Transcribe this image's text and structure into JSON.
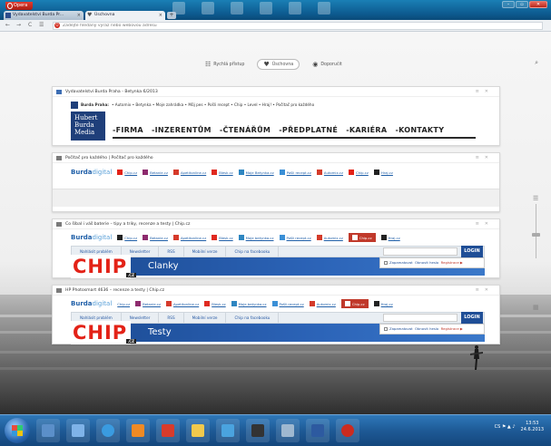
{
  "window": {
    "opera_label": "Opera",
    "controls": [
      "–",
      "▫",
      "✕"
    ]
  },
  "tabs": [
    {
      "label": "Vydavatelství Burda Pr...",
      "close": "×",
      "active": false
    },
    {
      "label": "Úschovna",
      "close": "×",
      "active": true
    }
  ],
  "new_tab_label": "+",
  "address": {
    "back": "←",
    "forward": "→",
    "reload": "C",
    "speed": "☰",
    "placeholder": "Zadejte hledaný výraz nebo webovou adresu"
  },
  "speeddial": {
    "items": [
      {
        "label": "Rychlá přístup",
        "icon": "grid-icon"
      },
      {
        "label": "Úschovna",
        "icon": "heart-icon",
        "active": true
      },
      {
        "label": "Doporučit",
        "icon": "eye-icon"
      }
    ]
  },
  "cards": {
    "burda_praha": {
      "title": "Vydavatelství Burda Praha - Betynka 6/2013",
      "nav_brand": "Burda Praha:",
      "nav_items": [
        "• Automix",
        "• Betynka",
        "• Moje zahrádka",
        "• Můj pes",
        "• Pošli recept",
        "• Chip",
        "• Level",
        "• Hraj!",
        "• Počítač pro každého"
      ],
      "logo_lines": [
        "Hubert",
        "Burda",
        "Media"
      ],
      "menu": [
        "-FIRMA",
        "-INZERENTŮM",
        "-ČTENÁŘŮM",
        "-PŘEDPLATNÉ",
        "-KARIÉRA",
        "-KONTAKTY"
      ]
    },
    "pocitac": {
      "title": "Počítač pro každého | Počítač pro každého",
      "logo_a": "Burda",
      "logo_b": "digital",
      "links": [
        "Chip.cz",
        "Betanie.cz",
        "Apetitonline.cz",
        "Blesk.cz",
        "Moje Betynka.cz",
        "Pošli recept.cz",
        "Automix.cz",
        "Chip.cz",
        "Hraj.cz"
      ]
    },
    "chip_clanky": {
      "title": "Co šíbal i váš baterie – tipy a triky, recenze a testy | Chip.cz",
      "logo_a": "Burda",
      "logo_b": "digital",
      "links": [
        "Chip.cz",
        "Betanie.cz",
        "Apetitonline.cz",
        "Blesk.cz",
        "Moje betynka.cz",
        "Pošli recept.cz",
        "Automix.cz",
        "Chip.cz",
        "Hraj.cz"
      ],
      "bar": [
        "Nahlásit problém",
        "Newsletter",
        "RSS",
        "Mobilní verze",
        "Chip na facebooku"
      ],
      "login": "LOGIN",
      "chip_logo": "CHIP",
      "chip_cz": ".CZ",
      "section": "Clanky",
      "remember": "Zapamatovat",
      "forgot": "Obnovit heslo",
      "register": "Registrace ▶"
    },
    "chip_testy": {
      "title": "HP Photosmart 4636 – recenze a testy | Chip.cz",
      "logo_a": "Burda",
      "logo_b": "digital",
      "links": [
        "Chip.cz",
        "Betanie.cz",
        "Apetitonline.cz",
        "Blesk.cz",
        "Moje betynka.cz",
        "Pošli recept.cz",
        "Automix.cz",
        "Chip.cz",
        "Hraj.cz"
      ],
      "bar": [
        "Nahlásit problém",
        "Newsletter",
        "RSS",
        "Mobilní verze",
        "Chip na facebooku"
      ],
      "login": "LOGIN",
      "chip_logo": "CHIP",
      "chip_cz": ".CZ",
      "section": "Testy",
      "remember": "Zapamatovat",
      "forgot": "Obnovit heslo",
      "register": "Registrace ▶"
    }
  },
  "taskbar": {
    "lang": "CS",
    "time": "13:53",
    "date": "24.6.2013"
  },
  "colors": {
    "chip_red": "#e32217",
    "chip_blue": "#1f4e96",
    "burda_blue": "#1f5fa8"
  }
}
